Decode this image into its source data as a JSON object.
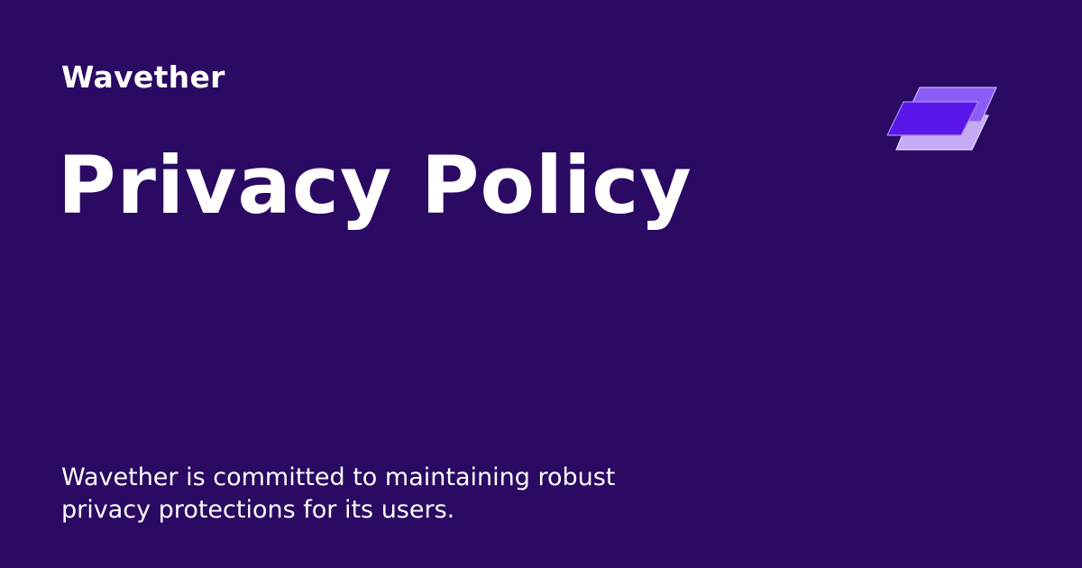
{
  "brand": "Wavether",
  "title": "Privacy Policy",
  "description": "Wavether is committed to maintaining robust privacy protections for its users.",
  "logo": {
    "icon": "stacked-layers-icon",
    "colors": {
      "back": "#c5aaf5",
      "middle": "#8b5cf6",
      "front": "#5b16ea"
    }
  },
  "background": "#2a0a63"
}
